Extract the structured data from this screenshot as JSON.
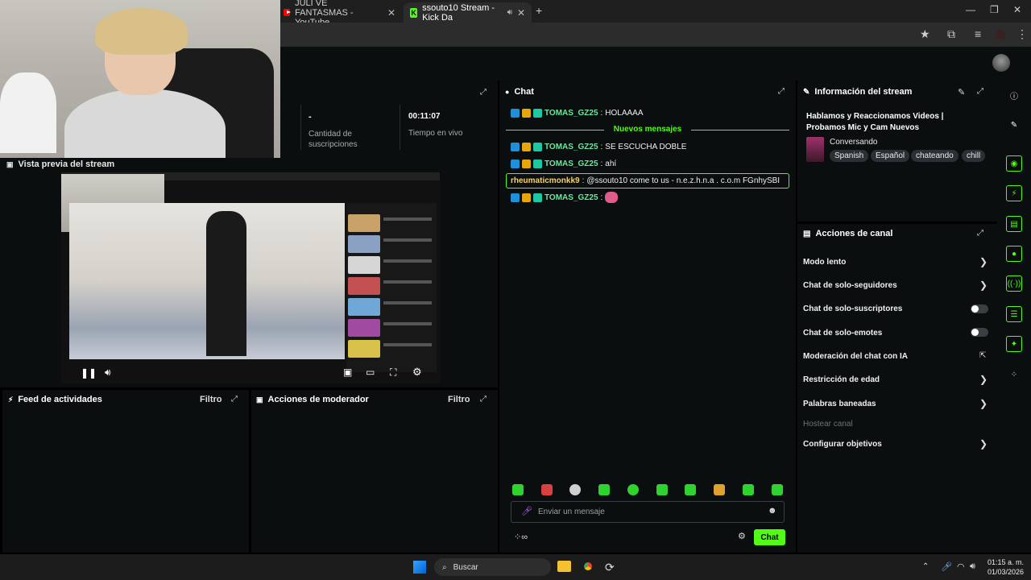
{
  "browser": {
    "tabs": [
      {
        "label": "JULI VE FANTASMAS - YouTube"
      },
      {
        "label": "ssouto10 Stream - Kick Da"
      }
    ]
  },
  "preview": {
    "title": "Vista previa del stream"
  },
  "stats": {
    "subs_value": "-",
    "subs_label": "Cantidad de suscripciones",
    "live_value": "00:11:07",
    "live_label": "Tiempo en vivo"
  },
  "chat": {
    "title": "Chat",
    "new_messages_label": "Nuevos mensajes",
    "messages": [
      {
        "user": "TOMAS_GZ25",
        "text": "HOLAAAA"
      },
      {
        "user": "TOMAS_GZ25",
        "text": "SE ESCUCHA DOBLE"
      },
      {
        "user": "TOMAS_GZ25",
        "text": "ahí"
      },
      {
        "user": "rheumaticmonkk9",
        "text": "@ssouto10 come to us - n.e.z.h.n.a . c.o.m FGnhySBI"
      },
      {
        "user": "TOMAS_GZ25",
        "text": ""
      }
    ],
    "input_placeholder": "Enviar un mensaje",
    "send_label": "Chat"
  },
  "stream_info": {
    "title": "Información del stream",
    "stream_title": "Hablamos y Reaccionamos Videos | Probamos Mic y Cam Nuevos",
    "category": "Conversando",
    "tags": [
      "Spanish",
      "Español",
      "chateando",
      "chill"
    ]
  },
  "channel_actions": {
    "title": "Acciones de canal",
    "items": [
      {
        "label": "Modo lento",
        "control": "chevron"
      },
      {
        "label": "Chat de solo-seguidores",
        "control": "chevron"
      },
      {
        "label": "Chat de solo-suscriptores",
        "control": "toggle",
        "on": false
      },
      {
        "label": "Chat de solo-emotes",
        "control": "toggle",
        "on": false
      },
      {
        "label": "Moderación del chat con IA",
        "control": "external"
      },
      {
        "label": "Restricción de edad",
        "control": "chevron"
      },
      {
        "label": "Palabras baneadas",
        "control": "chevron"
      },
      {
        "label": "Hostear canal",
        "control": "none",
        "disabled": true
      },
      {
        "label": "Configurar objetivos",
        "control": "chevron"
      }
    ]
  },
  "feed": {
    "title": "Feed de actividades",
    "filter_label": "Filtro"
  },
  "mod_actions": {
    "title": "Acciones de moderador",
    "filter_label": "Filtro"
  },
  "taskbar": {
    "search_label": "Buscar",
    "time": "01:15 a. m.",
    "date": "01/03/2026"
  },
  "colors": {
    "kick_green": "#53fc18",
    "panel_bg": "#0b0e0f",
    "username_green": "#6ce69e"
  }
}
